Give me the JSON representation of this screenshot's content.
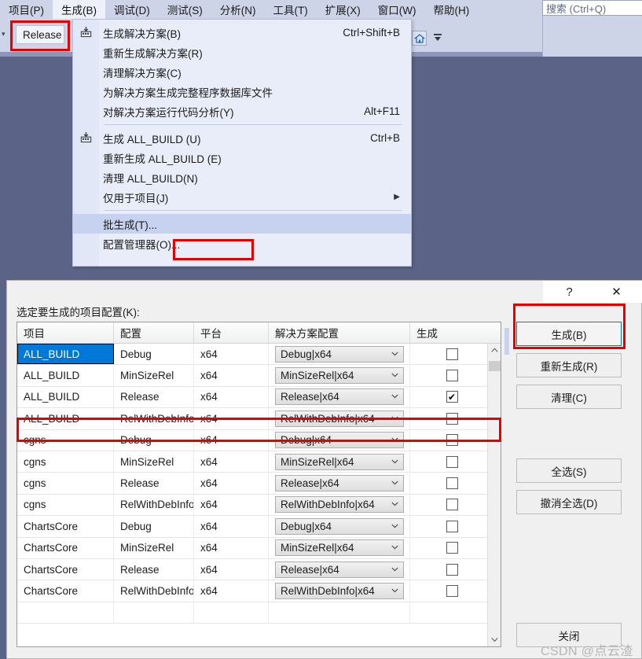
{
  "window": {
    "background_color": "#5b6487",
    "menubar_color": "#ced4e8"
  },
  "menubar": {
    "items": [
      {
        "label": "项目(P)",
        "active": false
      },
      {
        "label": "生成(B)",
        "active": true
      },
      {
        "label": "调试(D)",
        "active": false
      },
      {
        "label": "测试(S)",
        "active": false
      },
      {
        "label": "分析(N)",
        "active": false
      },
      {
        "label": "工具(T)",
        "active": false
      },
      {
        "label": "扩展(X)",
        "active": false
      },
      {
        "label": "窗口(W)",
        "active": false
      },
      {
        "label": "帮助(H)",
        "active": false
      }
    ]
  },
  "toolbar": {
    "configuration_value": "Release",
    "configuration_highlight_color": "#e80000",
    "build_icon": "build-solution-icon",
    "home_icon": "home-icon",
    "overflow_icon": "toolbar-overflow-icon"
  },
  "search": {
    "placeholder_text": "搜索 (Ctrl+Q)"
  },
  "build_menu": {
    "groups": [
      {
        "items": [
          {
            "icon": "build-solution-icon",
            "label": "生成解决方案(B)",
            "accelerator": "Ctrl+Shift+B",
            "submenu": false,
            "highlight": false
          },
          {
            "icon": "",
            "label": "重新生成解决方案(R)",
            "accelerator": "",
            "submenu": false,
            "highlight": false
          },
          {
            "icon": "",
            "label": "清理解决方案(C)",
            "accelerator": "",
            "submenu": false,
            "highlight": false
          },
          {
            "icon": "",
            "label": "为解决方案生成完整程序数据库文件",
            "accelerator": "",
            "submenu": false,
            "highlight": false
          },
          {
            "icon": "",
            "label": "对解决方案运行代码分析(Y)",
            "accelerator": "Alt+F11",
            "submenu": false,
            "highlight": false
          }
        ]
      },
      {
        "items": [
          {
            "icon": "build-project-icon",
            "label": "生成 ALL_BUILD (U)",
            "accelerator": "Ctrl+B",
            "submenu": false,
            "highlight": false
          },
          {
            "icon": "",
            "label": "重新生成 ALL_BUILD (E)",
            "accelerator": "",
            "submenu": false,
            "highlight": false
          },
          {
            "icon": "",
            "label": "清理 ALL_BUILD(N)",
            "accelerator": "",
            "submenu": false,
            "highlight": false
          },
          {
            "icon": "",
            "label": "仅用于项目(J)",
            "accelerator": "",
            "submenu": true,
            "highlight": false
          }
        ]
      },
      {
        "items": [
          {
            "icon": "",
            "label": "批生成(T)...",
            "accelerator": "",
            "submenu": false,
            "highlight": true
          },
          {
            "icon": "",
            "label": "配置管理器(O)...",
            "accelerator": "",
            "submenu": false,
            "highlight": false
          }
        ]
      }
    ],
    "highlight_box_color": "#e80000"
  },
  "dialog": {
    "titlebar": {
      "help_label": "?",
      "close_label": "✕"
    },
    "instruction_label": "选定要生成的项目配置(K):",
    "grid": {
      "columns": [
        "项目",
        "配置",
        "平台",
        "解决方案配置",
        "生成"
      ],
      "selected_row_index": 0,
      "selected_column_index": 0,
      "highlighted_row_index": 2,
      "selection_color": "#0078d7",
      "rows": [
        {
          "project": "ALL_BUILD",
          "configuration": "Debug",
          "platform": "x64",
          "solution_config": "Debug|x64",
          "build": false
        },
        {
          "project": "ALL_BUILD",
          "configuration": "MinSizeRel",
          "platform": "x64",
          "solution_config": "MinSizeRel|x64",
          "build": false
        },
        {
          "project": "ALL_BUILD",
          "configuration": "Release",
          "platform": "x64",
          "solution_config": "Release|x64",
          "build": true
        },
        {
          "project": "ALL_BUILD",
          "configuration": "RelWithDebInfo",
          "platform": "x64",
          "solution_config": "RelWithDebInfo|x64",
          "build": false
        },
        {
          "project": "cgns",
          "configuration": "Debug",
          "platform": "x64",
          "solution_config": "Debug|x64",
          "build": false
        },
        {
          "project": "cgns",
          "configuration": "MinSizeRel",
          "platform": "x64",
          "solution_config": "MinSizeRel|x64",
          "build": false
        },
        {
          "project": "cgns",
          "configuration": "Release",
          "platform": "x64",
          "solution_config": "Release|x64",
          "build": false
        },
        {
          "project": "cgns",
          "configuration": "RelWithDebInfo",
          "platform": "x64",
          "solution_config": "RelWithDebInfo|x64",
          "build": false
        },
        {
          "project": "ChartsCore",
          "configuration": "Debug",
          "platform": "x64",
          "solution_config": "Debug|x64",
          "build": false
        },
        {
          "project": "ChartsCore",
          "configuration": "MinSizeRel",
          "platform": "x64",
          "solution_config": "MinSizeRel|x64",
          "build": false
        },
        {
          "project": "ChartsCore",
          "configuration": "Release",
          "platform": "x64",
          "solution_config": "Release|x64",
          "build": false
        },
        {
          "project": "ChartsCore",
          "configuration": "RelWithDebInfo",
          "platform": "x64",
          "solution_config": "RelWithDebInfo|x64",
          "build": false
        },
        {
          "project": "",
          "configuration": "",
          "platform": "",
          "solution_config": "",
          "build": false
        }
      ],
      "scrollbar": {
        "up_icon": "chevron-up-icon",
        "down_icon": "chevron-down-icon"
      }
    },
    "buttons": {
      "build": {
        "label": "生成(B)",
        "focused": true,
        "highlight_color": "#e80000"
      },
      "rebuild": {
        "label": "重新生成(R)",
        "focused": false
      },
      "clean": {
        "label": "清理(C)",
        "focused": false
      },
      "select_all": {
        "label": "全选(S)",
        "focused": false
      },
      "deselect_all": {
        "label": "撤消全选(D)",
        "focused": false
      },
      "close": {
        "label": "关闭",
        "focused": false
      }
    }
  },
  "watermark": {
    "text": "CSDN @点云渣"
  }
}
